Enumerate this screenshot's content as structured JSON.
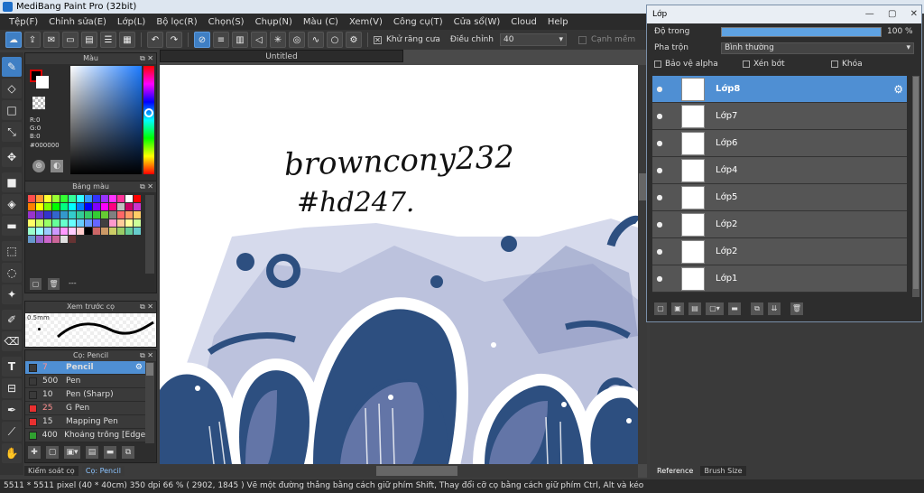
{
  "window": {
    "title": "MediBang Paint Pro (32bit)"
  },
  "menu": [
    "Tệp(F)",
    "Chỉnh sửa(E)",
    "Lớp(L)",
    "Bộ lọc(R)",
    "Chọn(S)",
    "Chụp(N)",
    "Màu (C)",
    "Xem(V)",
    "Công cụ(T)",
    "Cửa sổ(W)",
    "Cloud",
    "Help"
  ],
  "toolbar": {
    "antialias_label": "Khử răng cưa",
    "adjust_label": "Điều chỉnh",
    "adjust_value": "40",
    "strong_label": "Cạnh mềm"
  },
  "color_panel": {
    "title": "Màu",
    "r": "R:0",
    "g": "G:0",
    "b": "B:0",
    "hex": "#000000"
  },
  "palette_panel": {
    "title": "Bảng màu",
    "footer": "---"
  },
  "palette_colors": [
    "#ff4d4d",
    "#ff9933",
    "#ffff33",
    "#99ff33",
    "#33ff33",
    "#33ff99",
    "#33ffff",
    "#3399ff",
    "#3333ff",
    "#9933ff",
    "#ff33ff",
    "#ff3399",
    "#ffffff",
    "#ff0000",
    "#ff8000",
    "#ffff00",
    "#80ff00",
    "#00ff00",
    "#00ff80",
    "#00ffff",
    "#0080ff",
    "#0000ff",
    "#8000ff",
    "#ff00ff",
    "#ff0080",
    "#c0c0c0",
    "#cc0066",
    "#cc33cc",
    "#9933cc",
    "#6633cc",
    "#3333cc",
    "#3366cc",
    "#3399cc",
    "#33cccc",
    "#33cc99",
    "#33cc66",
    "#33cc33",
    "#66cc33",
    "#808080",
    "#ff6666",
    "#ff9966",
    "#ffcc66",
    "#ffff66",
    "#ccff66",
    "#99ff66",
    "#66ff99",
    "#66ffcc",
    "#66ffff",
    "#66ccff",
    "#6699ff",
    "#6666ff",
    "#404040",
    "#ff99cc",
    "#ffcc99",
    "#ffff99",
    "#ccff99",
    "#99ffcc",
    "#99ffff",
    "#99ccff",
    "#cc99ff",
    "#ff99ff",
    "#ffccff",
    "#ffcccc",
    "#000000",
    "#cc6666",
    "#cc9966",
    "#cccc66",
    "#99cc66",
    "#66cc99",
    "#66cccc",
    "#6699cc",
    "#9966cc",
    "#cc66cc",
    "#cc6699",
    "#e0e0e0",
    "#663333"
  ],
  "brush_preview": {
    "title": "Xem trước cọ",
    "size": "0.5mm"
  },
  "brush_panel": {
    "title": "Cọ: Pencil",
    "items": [
      {
        "size": "7",
        "name": "Pencil",
        "color": "#3a3a3a"
      },
      {
        "size": "500",
        "name": "Pen",
        "color": "#3a3a3a"
      },
      {
        "size": "10",
        "name": "Pen (Sharp)",
        "color": "#3a3a3a"
      },
      {
        "size": "25",
        "name": "G Pen",
        "color": "#e83030"
      },
      {
        "size": "15",
        "name": "Mapping Pen",
        "color": "#e83030"
      },
      {
        "size": "400",
        "name": "Khoảng trống [Edge l",
        "color": "#30a030"
      }
    ]
  },
  "left_bottom_tabs": [
    "Kiểm soát cọ",
    "Cọ: Pencil"
  ],
  "document": {
    "tab_title": "Untitled"
  },
  "canvas_text": {
    "line1": "browncony232",
    "line2": "#hd247."
  },
  "layer_window": {
    "title": "Lớp",
    "opacity_label": "Độ trong",
    "opacity_value": "100 %",
    "opacity_fraction": 1.0,
    "blend_label": "Pha trộn",
    "blend_value": "Bình thường",
    "protect_alpha": "Bảo vệ alpha",
    "clip": "Xén bớt",
    "lock": "Khóa",
    "layers": [
      "Lớp8",
      "Lớp7",
      "Lớp6",
      "Lớp4",
      "Lớp5",
      "Lớp2",
      "Lớp2",
      "Lớp1"
    ]
  },
  "right_bottom_tabs": [
    "Reference",
    "Brush Size"
  ],
  "status": "5511 * 5511 pixel  (40 * 40cm)  350 dpi  66 %  ( 2902, 1845 )  Vẽ một đường thẳng bằng cách giữ phím Shift, Thay đổi cỡ cọ bằng cách giữ phím Ctrl, Alt và kéo",
  "colors": {
    "accent": "#4f8fd3",
    "dark_blue": "#2d4f80",
    "lavender": "#b4bddb"
  }
}
